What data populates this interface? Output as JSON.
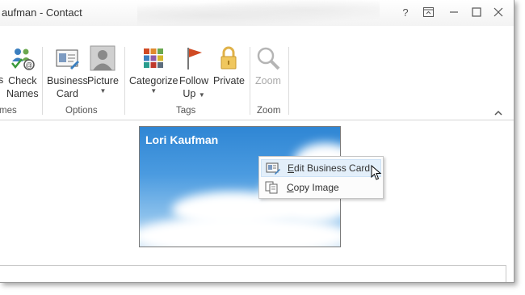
{
  "window": {
    "title": "aufman - Contact",
    "controls": [
      "?",
      "ribbon-display-options",
      "minimize",
      "maximize",
      "close"
    ]
  },
  "ribbon": {
    "names_group": {
      "partial_label": "s",
      "check_names_line1": "Check",
      "check_names_line2": "Names",
      "group_label_partial": "mes"
    },
    "options_group": {
      "business_card_line1": "Business",
      "business_card_line2": "Card",
      "picture_label": "Picture",
      "group_label": "Options"
    },
    "tags_group": {
      "categorize_label": "Categorize",
      "follow_up_line1": "Follow",
      "follow_up_line2": "Up",
      "private_label": "Private",
      "group_label": "Tags"
    },
    "zoom_group": {
      "zoom_label": "Zoom",
      "group_label": "Zoom"
    }
  },
  "business_card": {
    "name": "Lori Kaufman"
  },
  "context_menu": {
    "items": [
      {
        "label": "Edit Business Card",
        "icon": "business-card-edit-icon",
        "highlighted": true
      },
      {
        "label": "Copy Image",
        "icon": "copy-icon",
        "highlighted": false
      }
    ]
  },
  "colors": {
    "accent": "#d04a23",
    "hover": "#e3effa"
  }
}
